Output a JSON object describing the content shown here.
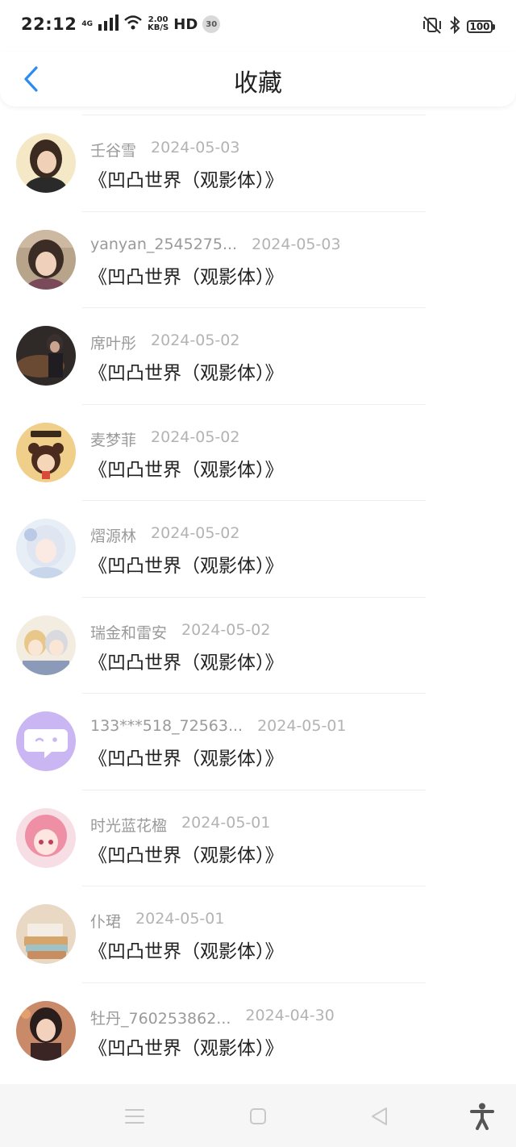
{
  "status_bar": {
    "time": "22:12",
    "network_type": "4G",
    "speed_value": "2.00",
    "speed_unit": "KB/S",
    "hd": "HD",
    "badge": "30",
    "battery": "100"
  },
  "nav": {
    "title": "收藏",
    "back_icon": "chevron-left-icon"
  },
  "colors": {
    "accent": "#2d8cf0",
    "name_text": "#9a9a9a",
    "date_text": "#b3b3b3",
    "book_text": "#222222"
  },
  "items": [
    {
      "name": "壬谷雪",
      "date": "2024-05-03",
      "book": "《凹凸世界（观影体）》"
    },
    {
      "name": "yanyan_2545275...",
      "date": "2024-05-03",
      "book": "《凹凸世界（观影体）》"
    },
    {
      "name": "席叶彤",
      "date": "2024-05-02",
      "book": "《凹凸世界（观影体）》"
    },
    {
      "name": "麦梦菲",
      "date": "2024-05-02",
      "book": "《凹凸世界（观影体）》"
    },
    {
      "name": "熠源林",
      "date": "2024-05-02",
      "book": "《凹凸世界（观影体）》"
    },
    {
      "name": "瑞金和雷安",
      "date": "2024-05-02",
      "book": "《凹凸世界（观影体）》"
    },
    {
      "name": "133***518_72563...",
      "date": "2024-05-01",
      "book": "《凹凸世界（观影体）》"
    },
    {
      "name": "时光蓝花楹",
      "date": "2024-05-01",
      "book": "《凹凸世界（观影体）》"
    },
    {
      "name": "仆珺",
      "date": "2024-05-01",
      "book": "《凹凸世界（观影体）》"
    },
    {
      "name": "牡丹_760253862...",
      "date": "2024-04-30",
      "book": "《凹凸世界（观影体）》"
    }
  ],
  "system_nav": {
    "menu_icon": "menu-icon",
    "home_icon": "square-home-icon",
    "back_icon": "triangle-back-icon",
    "accessibility_icon": "accessibility-icon"
  }
}
